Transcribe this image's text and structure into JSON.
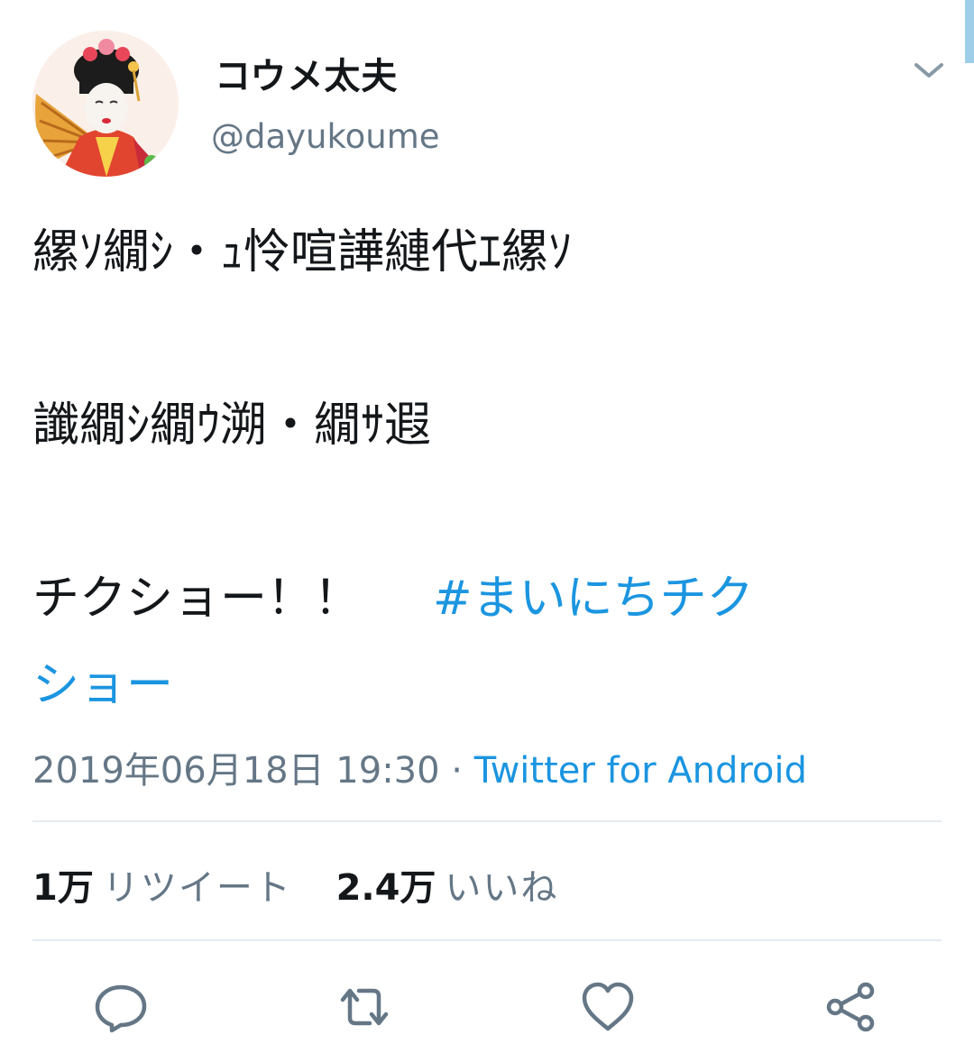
{
  "user": {
    "display_name": "コウメ太夫",
    "handle": "@dayukoume"
  },
  "tweet": {
    "line1": "縲ｿ繝ｼ・ｭ怜喧譁縺代ｴ縲ｿ",
    "line2": "讖繝ｼ繝ｳ溯・繝ｻ遐",
    "line3_text": "チクショー！！",
    "hashtag_part1": "#まいにちチク",
    "hashtag_part2": "ショー"
  },
  "meta": {
    "timestamp": "2019年06月18日 19:30",
    "separator": " · ",
    "source": "Twitter for Android"
  },
  "stats": {
    "retweet_count": "1万",
    "retweet_label": "リツイート",
    "like_count": "2.4万",
    "like_label": "いいね"
  },
  "icons": {
    "menu": "chevron-down-icon",
    "reply": "reply-icon",
    "retweet": "retweet-icon",
    "like": "heart-icon",
    "share": "share-icon"
  },
  "colors": {
    "link": "#1b95e0",
    "secondary_text": "#657786",
    "icon": "#657786",
    "divider": "#e6ecf0"
  }
}
